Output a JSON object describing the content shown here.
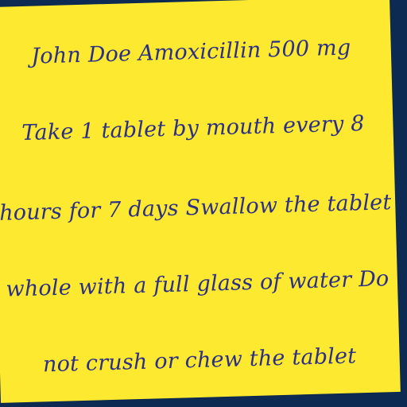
{
  "note": {
    "lines": [
      "John Doe Amoxicillin 500 mg",
      "Take 1 tablet by mouth every 8",
      "hours for 7 days Swallow the tablet",
      "whole with a full glass of water Do",
      "not crush or chew the tablet"
    ]
  },
  "colors": {
    "background": "#0d2a52",
    "paper": "#fde930",
    "ink": "#2c2f86"
  }
}
